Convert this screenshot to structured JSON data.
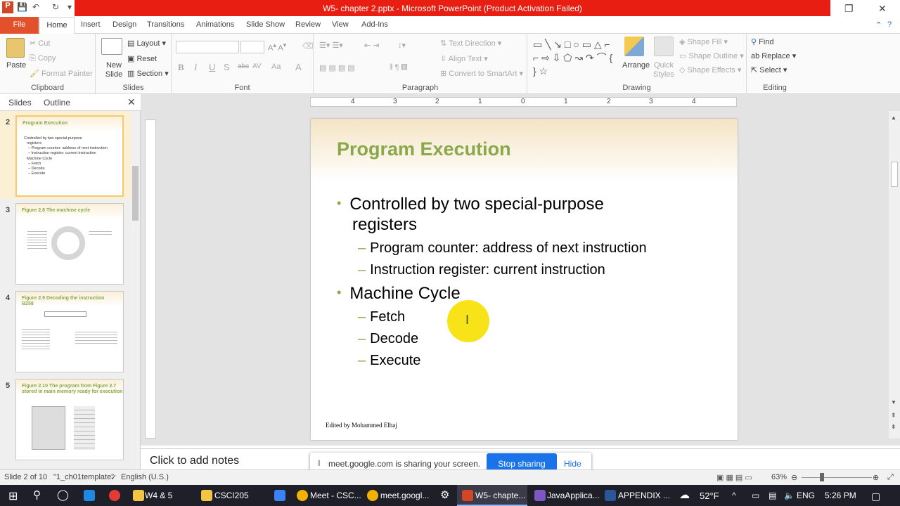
{
  "window": {
    "title": "W5- chapter 2.pptx - Microsoft PowerPoint (Product Activation Failed)"
  },
  "tabs": [
    "File",
    "Home",
    "Insert",
    "Design",
    "Transitions",
    "Animations",
    "Slide Show",
    "Review",
    "View",
    "Add-Ins"
  ],
  "ribbon": {
    "clipboard": {
      "paste": "Paste",
      "cut": "Cut",
      "copy": "Copy",
      "format_painter": "Format Painter",
      "label": "Clipboard"
    },
    "slides": {
      "new_slide": "New Slide",
      "layout": "Layout",
      "reset": "Reset",
      "section": "Section",
      "label": "Slides"
    },
    "font": {
      "label": "Font",
      "bold": "B",
      "italic": "I",
      "underline": "U",
      "shadow": "S",
      "strike": "abc",
      "spacing": "AV",
      "case": "Aa",
      "color": "A"
    },
    "paragraph": {
      "label": "Paragraph",
      "text_direction": "Text Direction",
      "align_text": "Align Text",
      "smartart": "Convert to SmartArt"
    },
    "drawing": {
      "label": "Drawing",
      "arrange": "Arrange",
      "quick_styles": "Quick Styles",
      "shape_fill": "Shape Fill",
      "shape_outline": "Shape Outline",
      "shape_effects": "Shape Effects"
    },
    "editing": {
      "label": "Editing",
      "find": "Find",
      "replace": "Replace",
      "select": "Select"
    }
  },
  "pane": {
    "tab_slides": "Slides",
    "tab_outline": "Outline"
  },
  "thumbnails": [
    {
      "num": "2",
      "title": "Program Execution",
      "lines": [
        "Controlled by two special-purpose",
        "registers",
        "– Program counter: address of next instruction",
        "– Instruction register: current instruction",
        "Machine Cycle",
        "– Fetch",
        "– Decode",
        "– Execute"
      ]
    },
    {
      "num": "3",
      "title": "Figure 2.8 The machine cycle"
    },
    {
      "num": "4",
      "title": "Figure 2.9 Decoding the instruction",
      "subtitle": "B258"
    },
    {
      "num": "5",
      "title": "Figure 2.10 The program from Figure 2.7",
      "subtitle": "stored in main memory ready for execution"
    }
  ],
  "ruler": {
    "h_ticks": [
      "4",
      "3",
      "2",
      "1",
      "0",
      "1",
      "2",
      "3",
      "4"
    ]
  },
  "slide": {
    "title": "Program Execution",
    "bullets": [
      {
        "level": 1,
        "text": "Controlled by two special-purpose"
      },
      {
        "level": 1,
        "text": "registers"
      },
      {
        "level": 2,
        "text": "Program counter: address of next instruction"
      },
      {
        "level": 2,
        "text": "Instruction register: current instruction"
      },
      {
        "level": 1,
        "text": "Machine Cycle"
      },
      {
        "level": 2,
        "text": "Fetch"
      },
      {
        "level": 2,
        "text": "Decode"
      },
      {
        "level": 2,
        "text": "Execute"
      }
    ],
    "footer": "Edited by Mohammed Elhaj"
  },
  "notes": {
    "placeholder": "Click to add notes"
  },
  "share": {
    "message": "meet.google.com is sharing your screen.",
    "stop": "Stop sharing",
    "hide": "Hide"
  },
  "status": {
    "slide": "Slide 2 of 10",
    "template": "\"1_ch01template\"",
    "language": "English (U.S.)",
    "zoom": "63%"
  },
  "taskbar": {
    "items": [
      "W4 & 5",
      "CSCI205",
      "Meet - CSC...",
      "meet.googl...",
      "W5- chapte...",
      "JavaApplica...",
      "APPENDIX ..."
    ],
    "weather": "52°F",
    "lang": "ENG",
    "time": "5:26 PM"
  },
  "colors": {
    "accent": "#8aa84a",
    "title_bar": "#e81e12",
    "file_tab": "#e2512b",
    "share_button": "#1a73e8"
  }
}
